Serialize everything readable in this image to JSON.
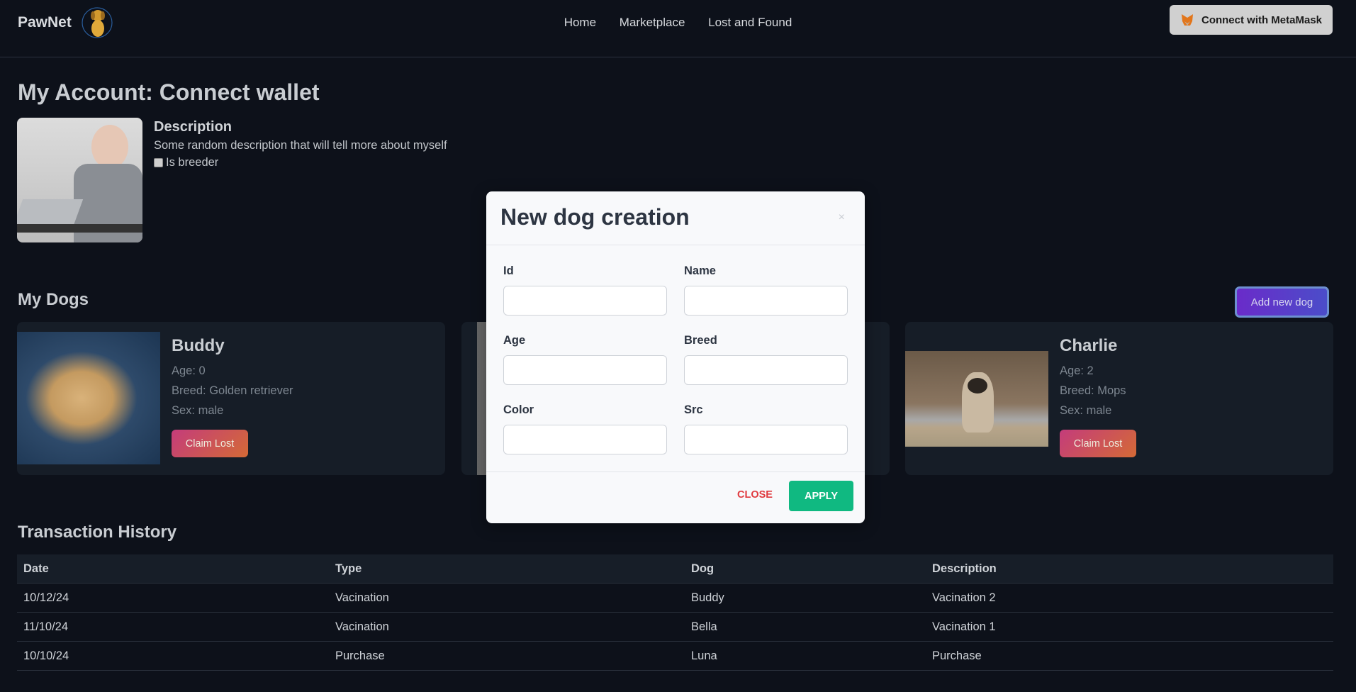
{
  "nav": {
    "brand": "PawNet",
    "links": [
      "Home",
      "Marketplace",
      "Lost and Found"
    ],
    "connect_label": "Connect with MetaMask"
  },
  "account": {
    "title": "My Account: Connect wallet",
    "description_heading": "Description",
    "description": "Some random description that will tell more about myself",
    "is_breeder_label": "Is breeder",
    "is_breeder": false
  },
  "dogs": {
    "heading": "My Dogs",
    "add_label": "Add new dog",
    "items": [
      {
        "name": "Buddy",
        "age": "Age: 0",
        "breed": "Breed: Golden retriever",
        "sex": "Sex: male",
        "action": "Claim Lost"
      },
      {
        "name": "Charlie",
        "age": "Age: 2",
        "breed": "Breed: Mops",
        "sex": "Sex: male",
        "action": "Claim Lost"
      }
    ]
  },
  "modal": {
    "title": "New dog creation",
    "close_x": "×",
    "fields": [
      {
        "label": "Id",
        "value": ""
      },
      {
        "label": "Name",
        "value": ""
      },
      {
        "label": "Age",
        "value": ""
      },
      {
        "label": "Breed",
        "value": ""
      },
      {
        "label": "Color",
        "value": ""
      },
      {
        "label": "Src",
        "value": ""
      }
    ],
    "close_label": "CLOSE",
    "apply_label": "APPLY"
  },
  "transactions": {
    "heading": "Transaction History",
    "columns": [
      "Date",
      "Type",
      "Dog",
      "Description"
    ],
    "rows": [
      [
        "10/12/24",
        "Vacination",
        "Buddy",
        "Vacination 2"
      ],
      [
        "11/10/24",
        "Vacination",
        "Bella",
        "Vacination 1"
      ],
      [
        "10/10/24",
        "Purchase",
        "Luna",
        "Purchase"
      ]
    ]
  },
  "colors": {
    "background": "#0d111a",
    "card": "#161d27",
    "apply": "#10b981",
    "close": "#e0393e",
    "add": "#6a2bc9"
  }
}
